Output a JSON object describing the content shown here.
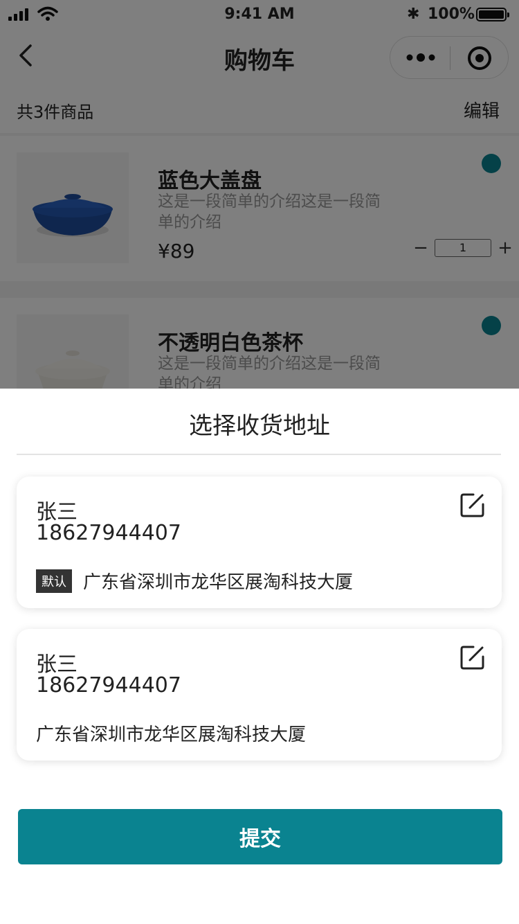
{
  "status_bar": {
    "time": "9:41 AM",
    "battery": "100%"
  },
  "nav": {
    "title": "购物车"
  },
  "cart": {
    "count_text": "共3件商品",
    "edit_label": "编辑",
    "items": [
      {
        "name": "蓝色大盖盘",
        "desc": "这是一段简单的介绍这是一段简单的介绍",
        "price": "¥89",
        "qty": "1",
        "minus": "−",
        "plus": "+"
      },
      {
        "name": "不透明白色茶杯",
        "desc": "这是一段简单的介绍这是一段简单的介绍"
      }
    ]
  },
  "address_sheet": {
    "title": "选择收货地址",
    "addresses": [
      {
        "name": "张三",
        "phone": "18627944407",
        "badge": "默认",
        "address": "广东省深圳市龙华区展淘科技大厦"
      },
      {
        "name": "张三",
        "phone": "18627944407",
        "address": "广东省深圳市龙华区展淘科技大厦"
      }
    ],
    "submit_label": "提交"
  },
  "colors": {
    "accent": "#0a8390",
    "badge_bg": "#333333"
  }
}
